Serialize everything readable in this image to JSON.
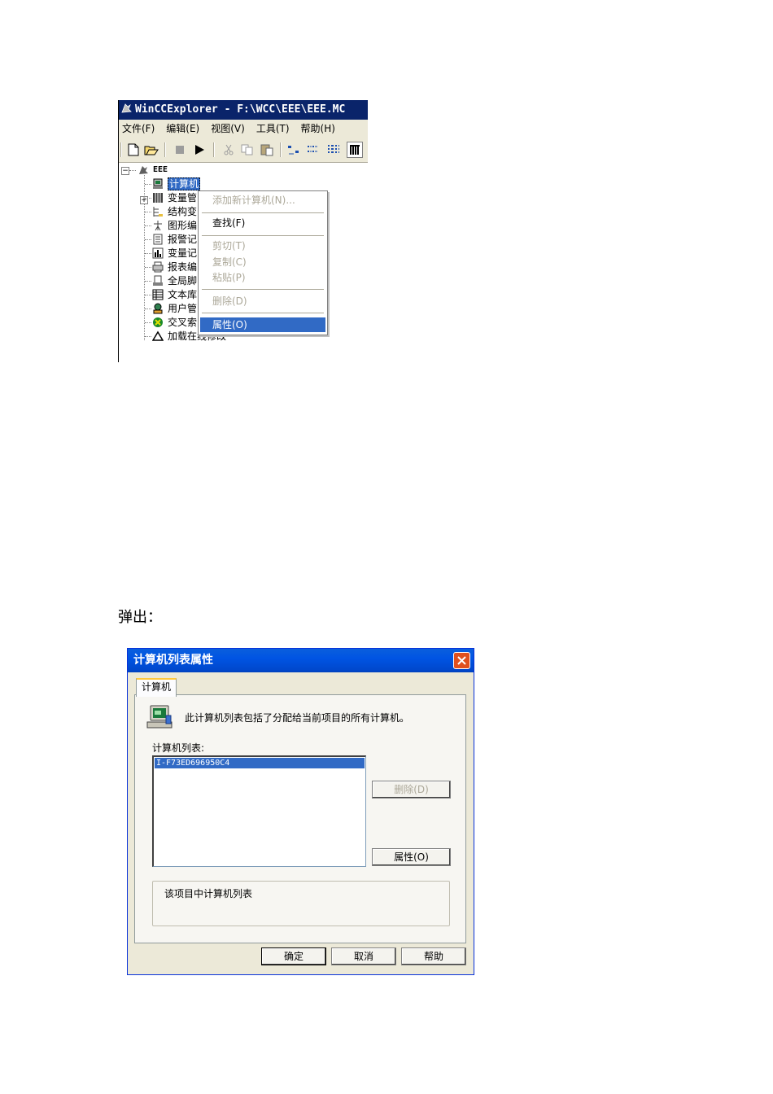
{
  "explorer": {
    "title": "WinCCExplorer - F:\\WCC\\EEE\\EEE.MC",
    "menu": [
      "文件(F)",
      "编辑(E)",
      "视图(V)",
      "工具(T)",
      "帮助(H)"
    ],
    "toolbar_icons": [
      "new-icon",
      "open-icon",
      "stop-icon",
      "run-icon",
      "cut-icon",
      "copy-icon",
      "paste-icon",
      "large-icons-icon",
      "small-icons-icon",
      "list-icon",
      "details-icon"
    ],
    "tree": {
      "root": "EEE",
      "items": [
        "计算机",
        "变量管",
        "结构变",
        "图形编",
        "报警记",
        "变量记",
        "报表编",
        "全局脚",
        "文本库",
        "用户管",
        "交叉索",
        "加载在线修改"
      ]
    },
    "context_menu": {
      "items": [
        {
          "label": "添加新计算机(N)...",
          "enabled": false
        },
        {
          "label": "查找(F)",
          "enabled": true
        },
        {
          "label": "剪切(T)",
          "enabled": false
        },
        {
          "label": "复制(C)",
          "enabled": false
        },
        {
          "label": "粘贴(P)",
          "enabled": false
        },
        {
          "label": "删除(D)",
          "enabled": false
        },
        {
          "label": "属性(O)",
          "enabled": true,
          "active": true
        }
      ]
    }
  },
  "caption": "弹出：",
  "dialog": {
    "title": "计算机列表属性",
    "tab": "计算机",
    "info": "此计算机列表包括了分配给当前项目的所有计算机。",
    "list_label": "计算机列表:",
    "list_items": [
      "I-F73ED696950C4"
    ],
    "delete_button": "删除(D)",
    "properties_button": "属性(O)",
    "description": "该项目中计算机列表",
    "ok_button": "确定",
    "cancel_button": "取消",
    "help_button": "帮助"
  },
  "colors": {
    "selection": "#316ac5",
    "classic_title": "#0a246a",
    "xp_title": "#0054e3",
    "dialog_face": "#ece9d8"
  }
}
